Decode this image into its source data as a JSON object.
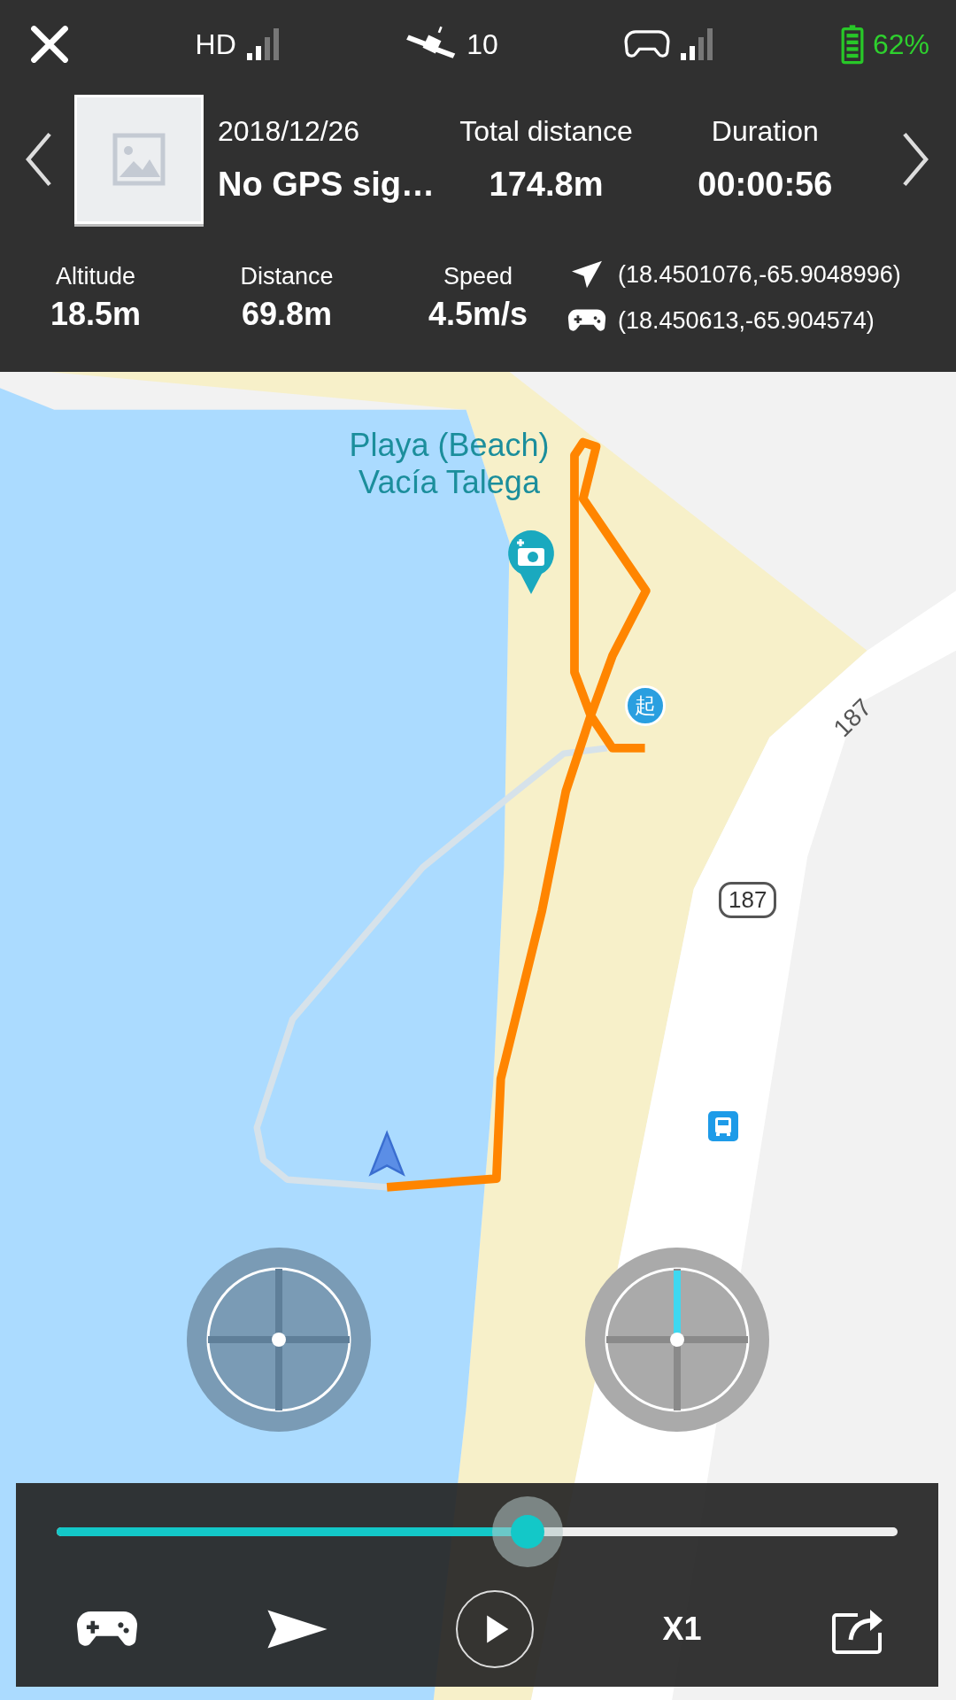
{
  "status_bar": {
    "video_quality": "HD",
    "satellites": "10",
    "battery": "62%"
  },
  "flight": {
    "date": "2018/12/26",
    "location": "No GPS sig…",
    "total_distance_label": "Total distance",
    "total_distance": "174.8m",
    "duration_label": "Duration",
    "duration": "00:00:56"
  },
  "stats": [
    {
      "label": "Altitude",
      "value": "18.5m"
    },
    {
      "label": "Distance",
      "value": "69.8m"
    },
    {
      "label": "Speed",
      "value": "4.5m/s"
    }
  ],
  "coordinates": [
    {
      "kind": "aircraft",
      "text": "(18.4501076,-65.9048996)"
    },
    {
      "kind": "controller",
      "text": "(18.450613,-65.904574)"
    }
  ],
  "map": {
    "place_label": "Playa (Beach) Vacía Talega",
    "start_marker": "起",
    "road_labels": [
      {
        "kind": "line",
        "text": "187"
      },
      {
        "kind": "shield",
        "text": "187"
      }
    ]
  },
  "playback": {
    "level": 0.56,
    "playing": false,
    "speed": "X1"
  }
}
